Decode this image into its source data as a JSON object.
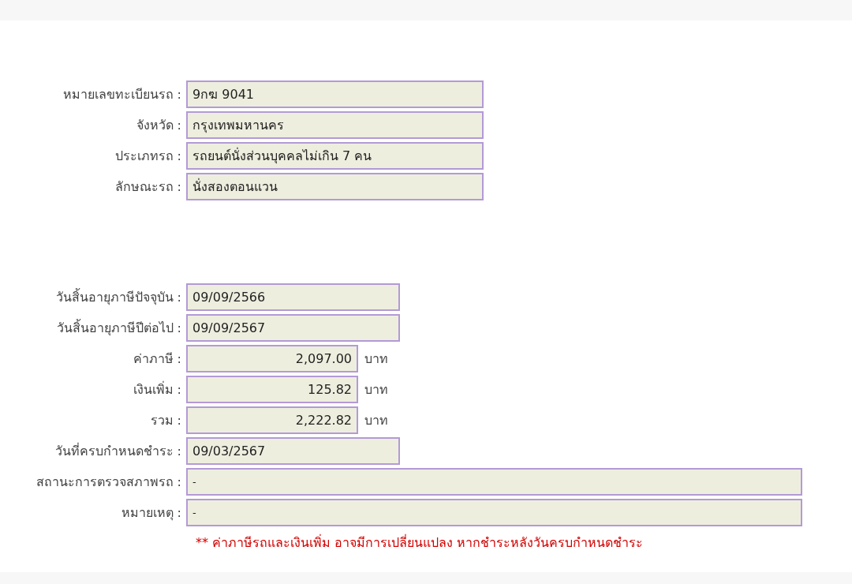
{
  "vehicle": [
    {
      "label": "หมายเลขทะเบียนรถ :",
      "value": "9กฆ 9041",
      "kind": "text"
    },
    {
      "label": "จังหวัด :",
      "value": "กรุงเทพมหานคร",
      "kind": "text"
    },
    {
      "label": "ประเภทรถ :",
      "value": "รถยนต์นั่งส่วนบุคคลไม่เกิน 7 คน",
      "kind": "text"
    },
    {
      "label": "ลักษณะรถ :",
      "value": "นั่งสองตอนแวน",
      "kind": "text"
    }
  ],
  "tax": [
    {
      "label": "วันสิ้นอายุภาษีปัจจุบัน :",
      "value": "09/09/2566",
      "kind": "date"
    },
    {
      "label": "วันสิ้นอายุภาษีปีต่อไป :",
      "value": "09/09/2567",
      "kind": "date"
    },
    {
      "label": "ค่าภาษี :",
      "value": "2,097.00",
      "kind": "amount",
      "unit": "บาท"
    },
    {
      "label": "เงินเพิ่ม :",
      "value": "125.82",
      "kind": "amount",
      "unit": "บาท"
    },
    {
      "label": "รวม :",
      "value": "2,222.82",
      "kind": "amount",
      "unit": "บาท"
    },
    {
      "label": "วันที่ครบกำหนดชำระ :",
      "value": "09/03/2567",
      "kind": "date"
    },
    {
      "label": "สถานะการตรวจสภาพรถ :",
      "value": "-",
      "kind": "remark"
    },
    {
      "label": "หมายเหตุ :",
      "value": "-",
      "kind": "remark"
    }
  ],
  "note": "** ค่าภาษีรถและเงินเพิ่ม อาจมีการเปลี่ยนแปลง หากชำระหลังวันครบกำหนดชำระ"
}
